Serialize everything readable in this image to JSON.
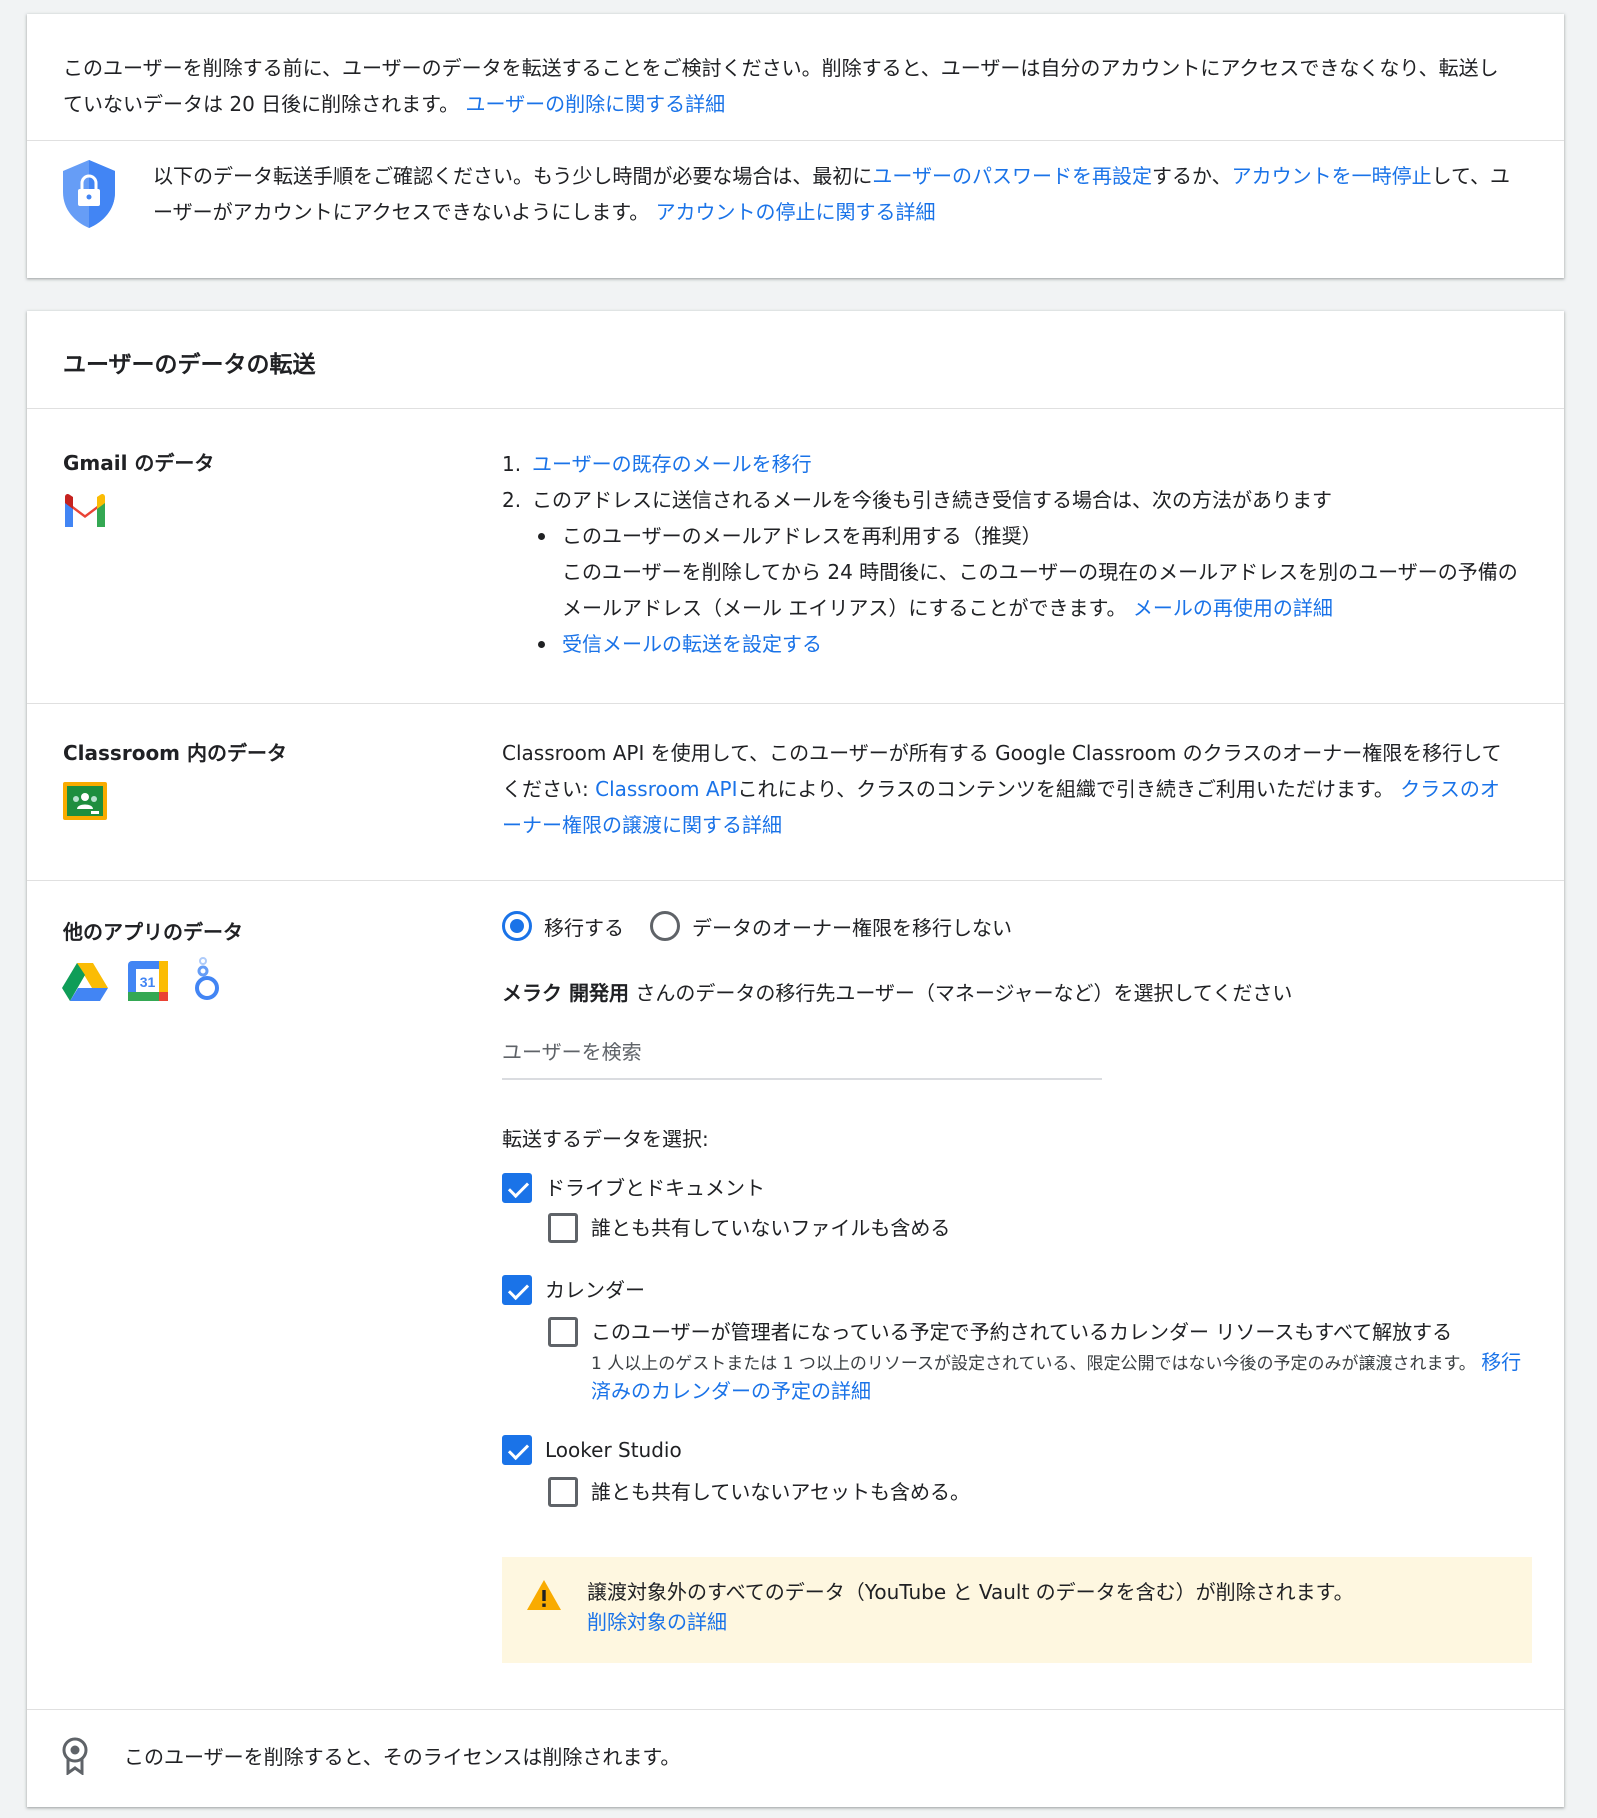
{
  "warning_card": {
    "intro_text": "このユーザーを削除する前に、ユーザーのデータを転送することをご検討ください。削除すると、ユーザーは自分のアカウントにアクセスできなくなり、転送していないデータは 20 日後に削除されます。 ",
    "intro_link": "ユーザーの削除に関する詳細",
    "steps_text_1": "以下のデータ転送手順をご確認ください。もう少し時間が必要な場合は、最初に",
    "steps_link_reset": "ユーザーのパスワードを再設定",
    "steps_text_2": "するか、",
    "steps_link_suspend": "アカウントを一時停止",
    "steps_text_3": "して、ユーザーがアカウントにアクセスできないようにします。 ",
    "steps_link_more": "アカウントの停止に関する詳細",
    "shield_icon": "shield-lock-icon"
  },
  "transfer_section": {
    "title": "ユーザーのデータの転送",
    "gmail": {
      "label": "Gmail のデータ",
      "icon": "gmail-icon",
      "item1_num": "1.",
      "item1_link": "ユーザーの既存のメールを移行",
      "item2_num": "2.",
      "item2_text": "このアドレスに送信されるメールを今後も引き続き受信する場合は、次の方法があります",
      "sub1_title": "このユーザーのメールアドレスを再利用する（推奨）",
      "sub1_desc": "このユーザーを削除してから 24 時間後に、このユーザーの現在のメールアドレスを別のユーザーの予備のメールアドレス（メール エイリアス）にすることができます。 ",
      "sub1_link": "メールの再使用の詳細",
      "sub2_link": "受信メールの転送を設定する"
    },
    "classroom": {
      "label": "Classroom 内のデータ",
      "icon": "classroom-icon",
      "text1": "Classroom API を使用して、このユーザーが所有する Google Classroom のクラスのオーナー権限を移行してください: ",
      "api_link": "Classroom API",
      "text2": "これにより、クラスのコンテンツを組織で引き続きご利用いただけます。 ",
      "more_link": "クラスのオーナー権限の譲渡に関する詳細"
    },
    "other_apps": {
      "label": "他のアプリのデータ",
      "icons": [
        "drive-icon",
        "calendar-icon",
        "looker-studio-icon"
      ],
      "calendar_day": "31",
      "radio_transfer": "移行する",
      "radio_no_transfer": "データのオーナー権限を移行しない",
      "radio_selected": "移行する",
      "user_name": "メラク 開発用",
      "select_user_text": " さんのデータの移行先ユーザー（マネージャーなど）を選択してください",
      "search_placeholder": "ユーザーを検索",
      "choose_data_title": "転送するデータを選択:",
      "drive_label": "ドライブとドキュメント",
      "drive_checked": true,
      "drive_sub_label": "誰とも共有していないファイルも含める",
      "drive_sub_checked": false,
      "calendar_label": "カレンダー",
      "calendar_checked": true,
      "calendar_sub_label": "このユーザーが管理者になっている予定で予約されているカレンダー リソースもすべて解放する",
      "calendar_sub_checked": false,
      "calendar_note": "1 人以上のゲストまたは 1 つ以上のリソースが設定されている、限定公開ではない今後の予定のみが譲渡されます。 ",
      "calendar_note_link": "移行済みのカレンダーの予定の詳細",
      "looker_label": "Looker Studio",
      "looker_checked": true,
      "looker_sub_label": "誰とも共有していないアセットも含める。",
      "looker_sub_checked": false
    },
    "warning": {
      "icon": "warning-icon",
      "text": "譲渡対象外のすべてのデータ（YouTube と Vault のデータを含む）が削除されます。",
      "link": "削除対象の詳細"
    },
    "license": {
      "icon": "license-icon",
      "text": "このユーザーを削除すると、そのライセンスは削除されます。"
    }
  },
  "colors": {
    "link": "#1a73e8",
    "warning_bg": "#fef7e0",
    "warning_icon": "#f9ab00"
  }
}
